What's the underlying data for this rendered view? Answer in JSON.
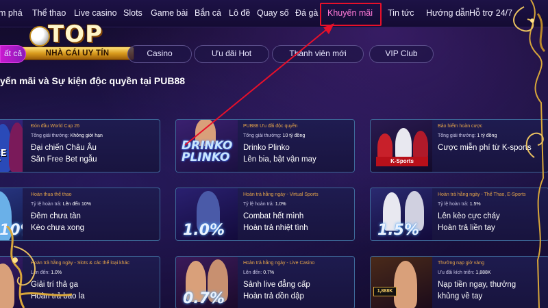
{
  "nav": {
    "items": [
      "m phá",
      "Thể thao",
      "Live casino",
      "Slots",
      "Game bài",
      "Bắn cá",
      "Lô đề",
      "Quay số",
      "Đá gà",
      "Khuyến mãi",
      "Tin tức",
      "Hướng dẫn",
      "Hỗ trợ 24/7"
    ],
    "active": "Khuyến mãi"
  },
  "logo": {
    "top_text": "TOP",
    "ribbon_text": "NHÀ CÁI UY TÍN"
  },
  "filters": [
    "ất cả",
    "Casino",
    "Ưu đãi Hot",
    "Thành viên mới",
    "VIP Club"
  ],
  "section_title": "yến mãi và Sự kiện độc quyền tại PUB88",
  "cards": [
    {
      "tag": "Đón đầu World Cup 26",
      "meta_label": "Tổng giải thưởng:",
      "meta_value": "Không giới hạn",
      "line1": "Đại chiến Châu Âu",
      "line2": "Săn Free Bet ngẫu",
      "thumb_text": "FREE BET"
    },
    {
      "tag": "PUB88 Ưu đãi độc quyền",
      "meta_label": "Tổng giải thưởng:",
      "meta_value": "10 tỷ đồng",
      "line1": "Drinko Plinko",
      "line2": "Lên bia, bật vận may",
      "thumb_text": "DRINKO PLINKO"
    },
    {
      "tag": "Bảo hiểm hoàn cược",
      "meta_label": "Tổng giải thưởng:",
      "meta_value": "1 tỷ đồng",
      "line1": "Cược miễn phí từ K-sports",
      "line2": "",
      "thumb_text": "K-Sports"
    },
    {
      "tag": "Hoàn thua thể thao",
      "meta_label": "Tỷ lệ hoàn trả:",
      "meta_value": "Lên đến 10%",
      "line1": "Đêm chưa tàn",
      "line2": "Kèo chưa xong",
      "thumb_text": "10%"
    },
    {
      "tag": "Hoàn trả hằng ngày - Virtual Sports",
      "meta_label": "Tỷ lệ hoàn trả:",
      "meta_value": "1.0%",
      "line1": "Combat hết mình",
      "line2": "Hoàn trả nhiệt tình",
      "thumb_text": "1.0%"
    },
    {
      "tag": "Hoàn trả hằng ngày - Thể Thao, E-Sports",
      "meta_label": "Tỷ lệ hoàn trả:",
      "meta_value": "1.5%",
      "line1": "Lên kèo cực cháy",
      "line2": "Hoàn trả liền tay",
      "thumb_text": "1.5%"
    },
    {
      "tag": "Hoàn trả hằng ngày - Slots & các thể loại khác",
      "meta_label": "Lên đến:",
      "meta_value": "1.0%",
      "line1": "Giải trí thả ga",
      "line2": "Hoàn trả bao la",
      "thumb_text": ""
    },
    {
      "tag": "Hoàn trả hằng ngày - Live Casino",
      "meta_label": "Lên đến:",
      "meta_value": "0.7%",
      "line1": "Sảnh live đẳng cấp",
      "line2": "Hoàn trả dồn dập",
      "thumb_text": "0.7%"
    },
    {
      "tag": "Thưởng nạp giờ vàng",
      "meta_label": "Ưu đãi kích triển:",
      "meta_value": "1,888K",
      "line1": "Nạp tiền ngay, thưởng",
      "line2": "khủng về tay",
      "thumb_text": "1,888K"
    }
  ],
  "colors": {
    "accent_pink": "#c81ad0",
    "highlight_red": "#e8102a",
    "gold": "#d8a63a",
    "tag_orange": "#e7a64a"
  }
}
